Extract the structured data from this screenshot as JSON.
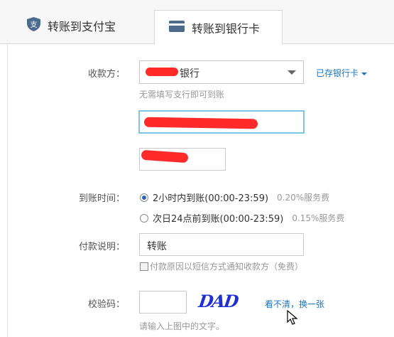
{
  "tabs": [
    {
      "label": "转账到支付宝",
      "icon": "shield-icon"
    },
    {
      "label": "转账到银行卡",
      "icon": "card-icon",
      "active": true
    }
  ],
  "form": {
    "payee_label": "收款方：",
    "bank_select_value": "银行",
    "saved_cards_link": "已存银行卡",
    "bank_hint": "无需填写支行即可到账",
    "arrival_label": "到账时间：",
    "arrival_options": [
      {
        "text": "2小时内到账(00:00-23:59)",
        "fee": "0.20%服务费",
        "selected": true
      },
      {
        "text": "次日24点前到账(00:00-23:59)",
        "fee": "0.15%服务费",
        "selected": false
      }
    ],
    "note_label": "付款说明：",
    "note_value": "转账",
    "notify_checkbox_label": "付款原因以短信方式通知收款方（免费）",
    "captcha_label": "校验码：",
    "captcha_text": "DAD",
    "captcha_refresh_link": "看不清，换一张",
    "captcha_hint": "请输入上图中的文字。"
  },
  "colors": {
    "link": "#1a73b8",
    "redaction": "#ff2a2a",
    "captcha": "#1f2fd1"
  }
}
